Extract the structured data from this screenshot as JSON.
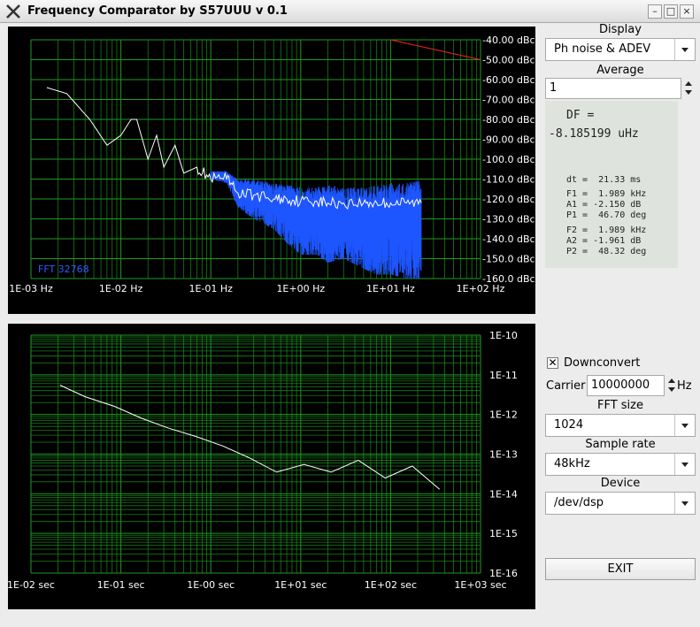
{
  "window": {
    "title": "Frequency Comparator by S57UUU  v 0.1",
    "minimize_icon": "minimize-icon",
    "maximize_icon": "maximize-icon",
    "close_icon": "close-icon"
  },
  "sidebar": {
    "display_label": "Display",
    "display_value": "Ph noise & ADEV",
    "average_label": "Average",
    "average_value": "1",
    "df_label": "DF =",
    "df_value": "-8.185199 uHz",
    "dt_line": "dt =  21.33 ms",
    "f1_line": "F1 =  1.989 kHz",
    "a1_line": "A1 = -2.150 dB",
    "p1_line": "P1 =  46.70 deg",
    "f2_line": "F2 =  1.989 kHz",
    "a2_line": "A2 = -1.961 dB",
    "p2_line": "P2 =  48.32 deg",
    "downconvert_label": "Downconvert",
    "downconvert_checked": true,
    "carrier_label": "Carrier",
    "carrier_value": "10000000",
    "carrier_unit": "Hz",
    "fft_size_label": "FFT size",
    "fft_size_value": "1024",
    "sample_rate_label": "Sample rate",
    "sample_rate_value": "48kHz",
    "device_label": "Device",
    "device_value": "/dev/dsp",
    "exit_label": "EXIT"
  },
  "colors": {
    "grid": "#1f9a1f",
    "trace": "#ffffff",
    "spectrum": "#1d55ff",
    "reference": "#ff2020",
    "fft_label": "#2f5cff"
  },
  "chart_data": [
    {
      "type": "line",
      "x_scale": "log",
      "xlim": [
        0.001,
        100
      ],
      "ylim": [
        -160,
        -40
      ],
      "x_tick_labels": [
        "1E-03 Hz",
        "1E-02 Hz",
        "1E-01 Hz",
        "1E+00 Hz",
        "1E+01 Hz",
        "1E+02 Hz"
      ],
      "y_tick_labels": [
        "-40.00 dBc",
        "-50.00 dBc",
        "-60.00 dBc",
        "-70.00 dBc",
        "-80.00 dBc",
        "-90.00 dBc",
        "-100.0 dBc",
        "-110.0 dBc",
        "-120.0 dBc",
        "-130.0 dBc",
        "-140.0 dBc",
        "-150.0 dBc",
        "-160.0 dBc"
      ],
      "annotation": "FFT 32768",
      "series": [
        {
          "x": [
            0.0015,
            0.0025,
            0.0045,
            0.007,
            0.01,
            0.013,
            0.015,
            0.02,
            0.025,
            0.03,
            0.04,
            0.05,
            0.07,
            0.1,
            0.15,
            0.2,
            0.3,
            0.5,
            0.7,
            1,
            1.5,
            2,
            3,
            5,
            7,
            10,
            15,
            22
          ],
          "y": [
            -64,
            -67,
            -80,
            -93,
            -88,
            -80,
            -80,
            -100,
            -88,
            -104,
            -93,
            -107,
            -104,
            -110,
            -110,
            -117,
            -118,
            -120,
            -120,
            -121,
            -121,
            -122,
            -122,
            -122,
            -122,
            -122,
            -122,
            -122
          ]
        },
        {
          "x": [
            0.1,
            0.15,
            0.2,
            0.3,
            0.5,
            0.7,
            1,
            1.5,
            2,
            3,
            5,
            7,
            10,
            15,
            22
          ],
          "y_low": [
            -110,
            -112,
            -124,
            -130,
            -135,
            -142,
            -148,
            -148,
            -152,
            -150,
            -155,
            -158,
            -158,
            -160,
            -160
          ],
          "y_high": [
            -106,
            -106,
            -110,
            -110,
            -112,
            -113,
            -114,
            -114,
            -113,
            -114,
            -114,
            -113,
            -112,
            -112,
            -110
          ]
        },
        {
          "x": [
            10,
            100
          ],
          "y": [
            -40,
            -50
          ]
        }
      ]
    },
    {
      "type": "line",
      "x_scale": "log",
      "y_scale": "log",
      "xlim": [
        0.01,
        1000
      ],
      "ylim": [
        1e-16,
        1e-10
      ],
      "x_tick_labels": [
        "1E-02 sec",
        "1E-01 sec",
        "1E-00 sec",
        "1E+01 sec",
        "1E+02 sec",
        "1E+03 sec"
      ],
      "y_tick_labels": [
        "1E-10",
        "1E-11",
        "1E-12",
        "1E-13",
        "1E-14",
        "1E-15",
        "1E-16"
      ],
      "series": [
        {
          "x": [
            0.021,
            0.04,
            0.085,
            0.17,
            0.34,
            0.68,
            1.36,
            2.7,
            5.4,
            10.9,
            21.8,
            43.6,
            87,
            174,
            350
          ],
          "y": [
            5.5e-12,
            2.8e-12,
            1.6e-12,
            8e-13,
            4.5e-13,
            2.8e-13,
            1.6e-13,
            8e-14,
            3.5e-14,
            5.5e-14,
            3.5e-14,
            7e-14,
            2.5e-14,
            5e-14,
            1.3e-14
          ]
        }
      ]
    }
  ]
}
